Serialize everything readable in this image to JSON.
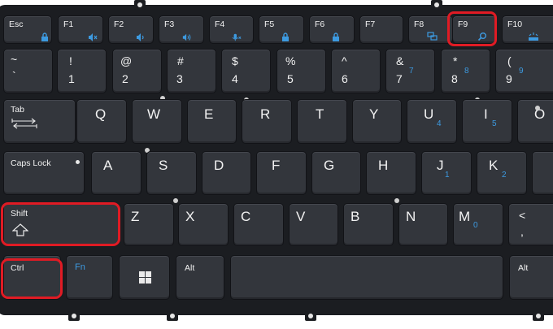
{
  "accent_blue": "#3d9ae0",
  "highlight_red": "#e01b24",
  "keys": {
    "esc": "Esc",
    "f1": "F1",
    "f2": "F2",
    "f3": "F3",
    "f4": "F4",
    "f5": "F5",
    "f6": "F6",
    "f7": "F7",
    "f8": "F8",
    "f9": "F9",
    "f10": "F10",
    "tilde_top": "~",
    "tilde_bottom": "`",
    "n1_top": "!",
    "n1": "1",
    "n2_top": "@",
    "n2": "2",
    "n3_top": "#",
    "n3": "3",
    "n4_top": "$",
    "n4": "4",
    "n5_top": "%",
    "n5": "5",
    "n6_top": "^",
    "n6": "6",
    "n7_top": "&",
    "n7": "7",
    "n7_blue": "7",
    "n8_top": "*",
    "n8": "8",
    "n8_blue": "8",
    "n9_top": "(",
    "n9": "9",
    "n9_blue": "9",
    "tab": "Tab",
    "q": "Q",
    "w": "W",
    "e": "E",
    "r": "R",
    "t": "T",
    "y": "Y",
    "u": "U",
    "u_blue": "4",
    "i": "I",
    "i_blue": "5",
    "o": "O",
    "caps": "Caps Lock",
    "a": "A",
    "s": "S",
    "d": "D",
    "f": "F",
    "g": "G",
    "h": "H",
    "j": "J",
    "j_blue": "1",
    "k": "K",
    "k_blue": "2",
    "shift": "Shift",
    "z": "Z",
    "x": "X",
    "c": "C",
    "v": "V",
    "b": "B",
    "n": "N",
    "m": "M",
    "m_blue": "0",
    "comma_top": "<",
    "comma": ",",
    "ctrl": "Ctrl",
    "fn": "Fn",
    "alt": "Alt",
    "alt_right": "Alt"
  },
  "icons": {
    "esc": "lock-icon",
    "f1": "mute-icon",
    "f2": "volume-down-icon",
    "f3": "volume-up-icon",
    "f4": "microphone-mute-icon",
    "f5": "num-lock-icon",
    "f6": "scroll-lock-icon",
    "f8": "display-switch-icon",
    "f9": "search-icon",
    "f10": "keyboard-backlight-icon",
    "tab": "tab-arrows-icon",
    "shift": "shift-arrow-icon",
    "windows": "windows-logo-icon"
  }
}
